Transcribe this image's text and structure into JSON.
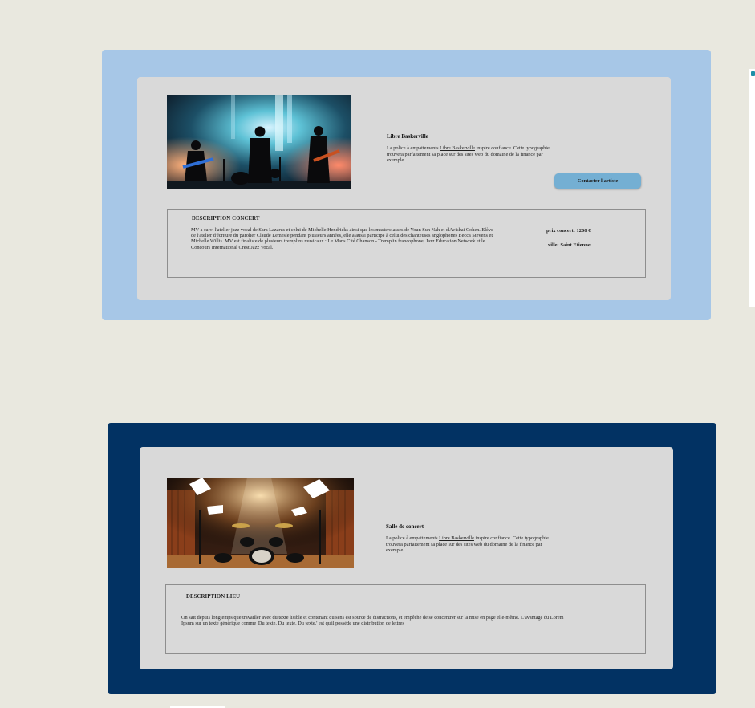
{
  "cards": [
    {
      "theme_color": "#a7c7e7",
      "image_icon": "concert-band-photo",
      "title": "Libre Baskerville",
      "desc_prefix": "La police à empattements ",
      "desc_link": "Libre Baskerville",
      "desc_suffix": " inspire confiance. Cette typographie trouvera parfaitement sa place sur des sites web du domaine de la finance par exemple.",
      "button_label": "Contacter l'artiste",
      "section_title": "DESCRIPTION CONCERT",
      "section_text": "MV a suivi l'atelier jazz vocal de Sara Lazarus et celui de Michelle  Hendricks ainsi que les masterclasses de Youn Sun Nah et d'Avishai  Cohen. Elève de l'atelier d'écriture du parolier Claude Lemesle pendant  plusieurs années, elle a aussi participé à celui des chanteuses  anglophones Becca Stevens et Michelle Willis. MV est finaliste de  plusieurs tremplins musicaux : Le Mans Cité Chanson - Tremplin  francophone, Jazz Education Network et le Concours International Crest  Jazz Vocal.",
      "price": "prix concert: 1200 €",
      "city": "ville: Saint Etienne"
    },
    {
      "theme_color": "#023263",
      "image_icon": "stage-drums-photo",
      "title": "Salle de concert",
      "desc_prefix": "La police à empattements ",
      "desc_link": "Libre Baskerville",
      "desc_suffix": " inspire confiance. Cette typographie trouvera parfaitement sa place sur des sites web du domaine de la finance par exemple.",
      "section_title": "DESCRIPTION LIEU",
      "section_text": "On sait depuis longtemps que travailler avec du texte lisible et  contenant du sens est source de distractions, et empêche de se  concentrer sur la mise en page elle-même. L'avantage du Lorem Ipsum sur  un texte générique comme 'Du texte. Du texte. Du texte.' est qu'il  possède une distribution de lettres"
    }
  ]
}
